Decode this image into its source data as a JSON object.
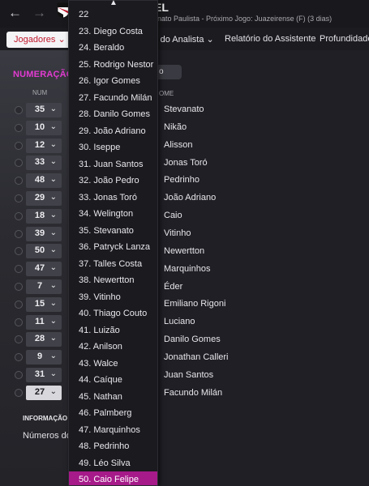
{
  "topbar": {
    "back_icon": "arrow-left-icon",
    "forward_icon": "arrow-right-icon",
    "team_name": "EL",
    "next_match": "nato Paulista - Próximo Jogo: Juazeirense (F) (3 dias)",
    "crest_label": "SP"
  },
  "subbar": {
    "jogadores_label": "Jogadores",
    "tabs": [
      "io do Analista",
      "Relatório do Assistente",
      "Profundidade"
    ]
  },
  "left": {
    "section_title": "NUMERAÇÃO",
    "column_header": "NUM",
    "numbers": [
      "35",
      "10",
      "12",
      "33",
      "48",
      "29",
      "18",
      "39",
      "50",
      "47",
      "7",
      "15",
      "11",
      "28",
      "9",
      "31",
      "27"
    ],
    "info_title": "INFORMAÇÃO",
    "info_text": "Números do"
  },
  "right": {
    "filter_label": "o",
    "column_header": "OME",
    "players": [
      "Stevanato",
      "Nikão",
      "Alisson",
      "Jonas Toró",
      "Pedrinho",
      "João Adriano",
      "Caio",
      "Vitinho",
      "Newertton",
      "Marquinhos",
      "Éder",
      "Emiliano Rigoni",
      "Luciano",
      "Danilo Gomes",
      "Jonathan Calleri",
      "Juan Santos",
      "Facundo Milán"
    ]
  },
  "dropdown": {
    "items": [
      "22",
      "23. Diego Costa",
      "24. Beraldo",
      "25. Rodrigo Nestor",
      "26. Igor Gomes",
      "27. Facundo Milán",
      "28. Danilo Gomes",
      "29. João Adriano",
      "30. Iseppe",
      "31. Juan Santos",
      "32. João Pedro",
      "33. Jonas Toró",
      "34. Welington",
      "35. Stevanato",
      "36. Patryck Lanza",
      "37. Talles Costa",
      "38. Newertton",
      "39. Vitinho",
      "40. Thiago Couto",
      "41. Luizão",
      "42. Anilson",
      "43. Walce",
      "44. Caíque",
      "45. Nathan",
      "46. Palmberg",
      "47. Marquinhos",
      "48. Pedrinho",
      "49. Léo Silva",
      "50. Caio Felipe"
    ],
    "selected_index": 28
  },
  "colors": {
    "accent": "#e23bd1",
    "selected": "#a61a8a",
    "brand": "#c0182d"
  }
}
